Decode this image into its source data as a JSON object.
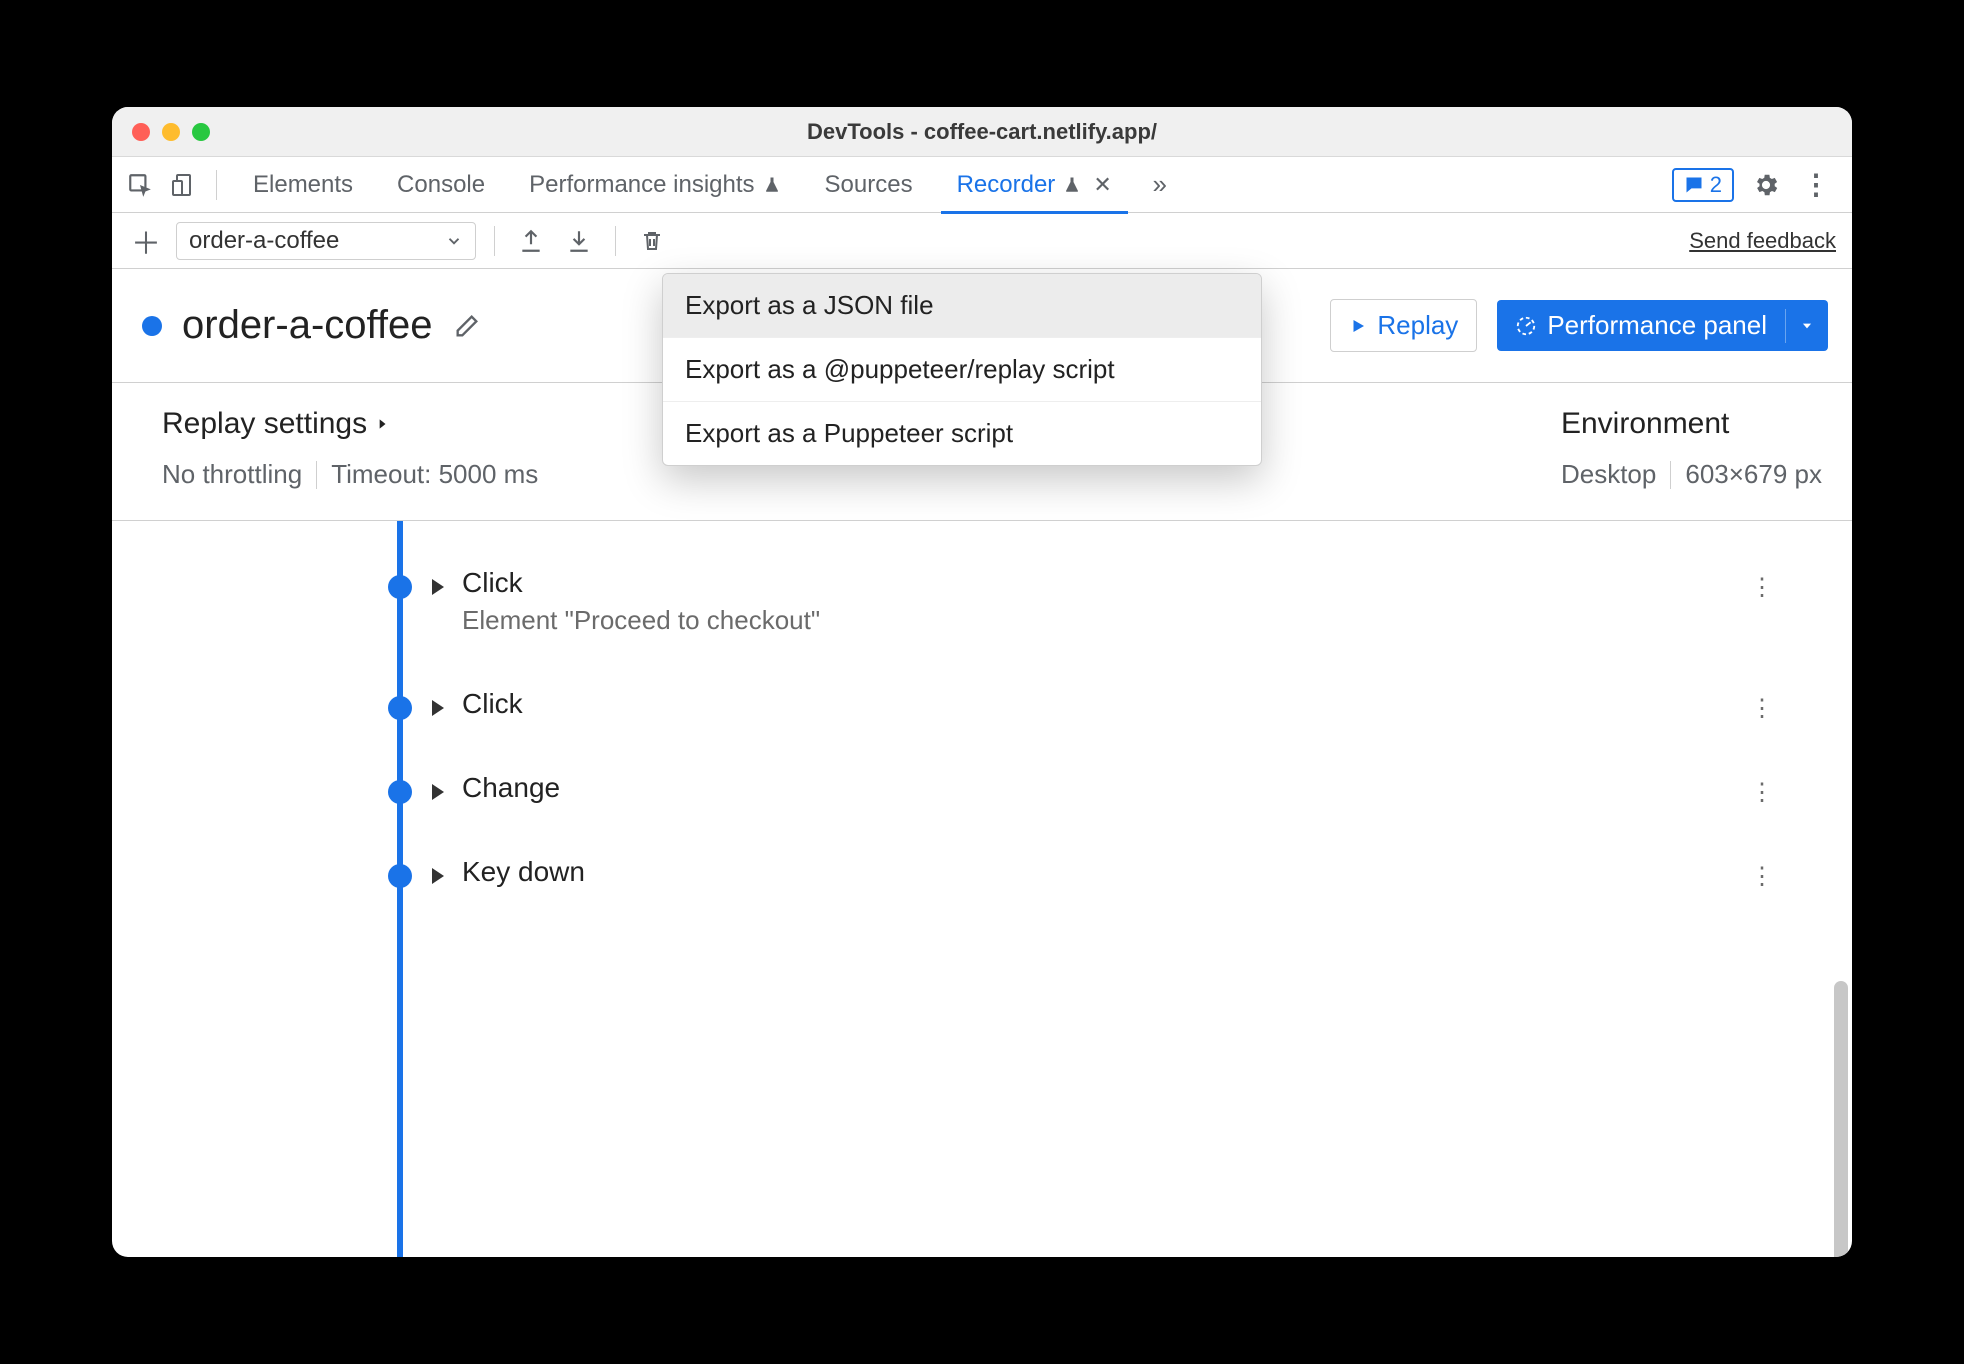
{
  "window": {
    "title": "DevTools - coffee-cart.netlify.app/"
  },
  "tabs": {
    "items": [
      {
        "label": "Elements",
        "flask": false,
        "active": false
      },
      {
        "label": "Console",
        "flask": false,
        "active": false
      },
      {
        "label": "Performance insights",
        "flask": true,
        "active": false
      },
      {
        "label": "Sources",
        "flask": false,
        "active": false
      },
      {
        "label": "Recorder",
        "flask": true,
        "active": true,
        "closable": true
      }
    ],
    "messages_count": "2"
  },
  "rec_toolbar": {
    "selected_recording": "order-a-coffee",
    "feedback_label": "Send feedback"
  },
  "export_menu": {
    "items": [
      {
        "label": "Export as a JSON file",
        "hover": true
      },
      {
        "label": "Export as a @puppeteer/replay script",
        "hover": false
      },
      {
        "label": "Export as a Puppeteer script",
        "hover": false
      }
    ]
  },
  "header": {
    "title": "order-a-coffee",
    "replay_label": "Replay",
    "perf_label": "Performance panel"
  },
  "settings": {
    "replay_heading": "Replay settings",
    "throttling": "No throttling",
    "timeout": "Timeout: 5000 ms",
    "env_heading": "Environment",
    "device": "Desktop",
    "viewport": "603×679 px"
  },
  "steps": [
    {
      "label": "Click",
      "detail": "Element \"Proceed to checkout\""
    },
    {
      "label": "Click",
      "detail": ""
    },
    {
      "label": "Change",
      "detail": ""
    },
    {
      "label": "Key down",
      "detail": ""
    }
  ]
}
